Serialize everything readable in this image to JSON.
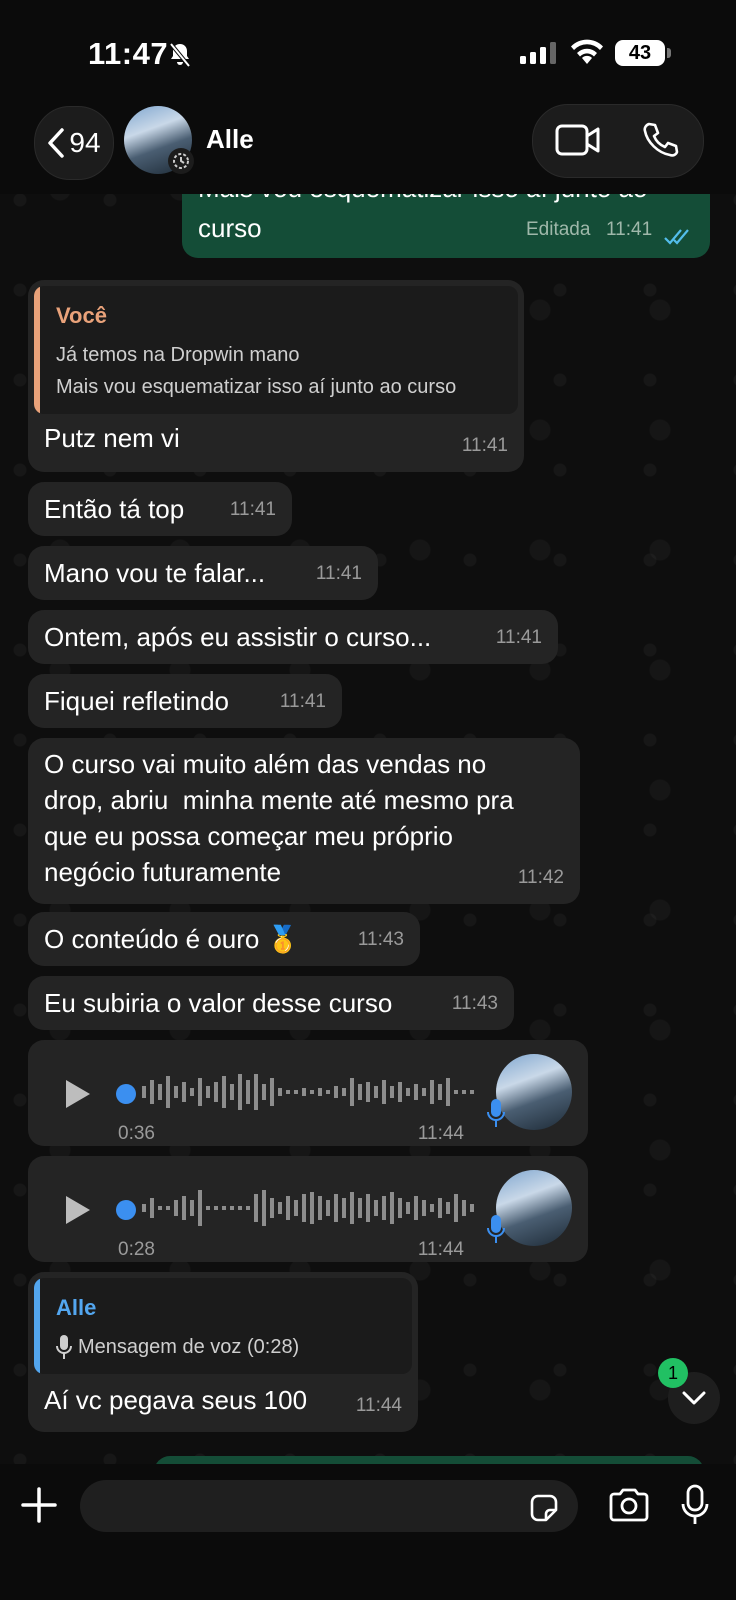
{
  "status_bar": {
    "time": "11:47",
    "battery": "43"
  },
  "header": {
    "back_count": "94",
    "contact_name": "Alle"
  },
  "messages": {
    "top_out": {
      "text_partial": "Mais vou esquematizar isso aí junto ao",
      "text": "curso",
      "edited_label": "Editada",
      "time": "11:41"
    },
    "reply1": {
      "quote_author": "Você",
      "quote_line1": "Já temos na Dropwin mano",
      "quote_line2": "Mais vou esquematizar isso aí junto ao curso",
      "text": "Putz nem vi",
      "time": "11:41"
    },
    "m1": {
      "text": "Então tá top",
      "time": "11:41"
    },
    "m2": {
      "text": "Mano vou te falar...",
      "time": "11:41"
    },
    "m3": {
      "text": "Ontem, após eu assistir o curso...",
      "time": "11:41"
    },
    "m4": {
      "text": "Fiquei refletindo",
      "time": "11:41"
    },
    "m5": {
      "line1": "O curso vai muito além das vendas no",
      "line2": "drop, abriu  minha mente até mesmo pra",
      "line3": "que eu possa começar meu próprio",
      "line4": "negócio futuramente",
      "time": "11:42"
    },
    "m6": {
      "text": "O conteúdo é ouro 🥇",
      "time": "11:43"
    },
    "m7": {
      "text": "Eu subiria o valor desse curso",
      "time": "11:43"
    },
    "voice1": {
      "duration": "0:36",
      "time": "11:44"
    },
    "voice2": {
      "duration": "0:28",
      "time": "11:44"
    },
    "reply2": {
      "quote_author": "Alle",
      "quote_line1": "Mensagem de voz (0:28)",
      "text": "Aí vc pegava seus 100",
      "time": "11:44"
    }
  },
  "scroll": {
    "unread": "1"
  },
  "colors": {
    "accent_green": "#21c063",
    "out_bubble": "#144d37",
    "in_bubble": "#242424",
    "voice_blue": "#3b8ff0",
    "quote_you": "#e9a27a",
    "quote_alle": "#53a6ef"
  }
}
